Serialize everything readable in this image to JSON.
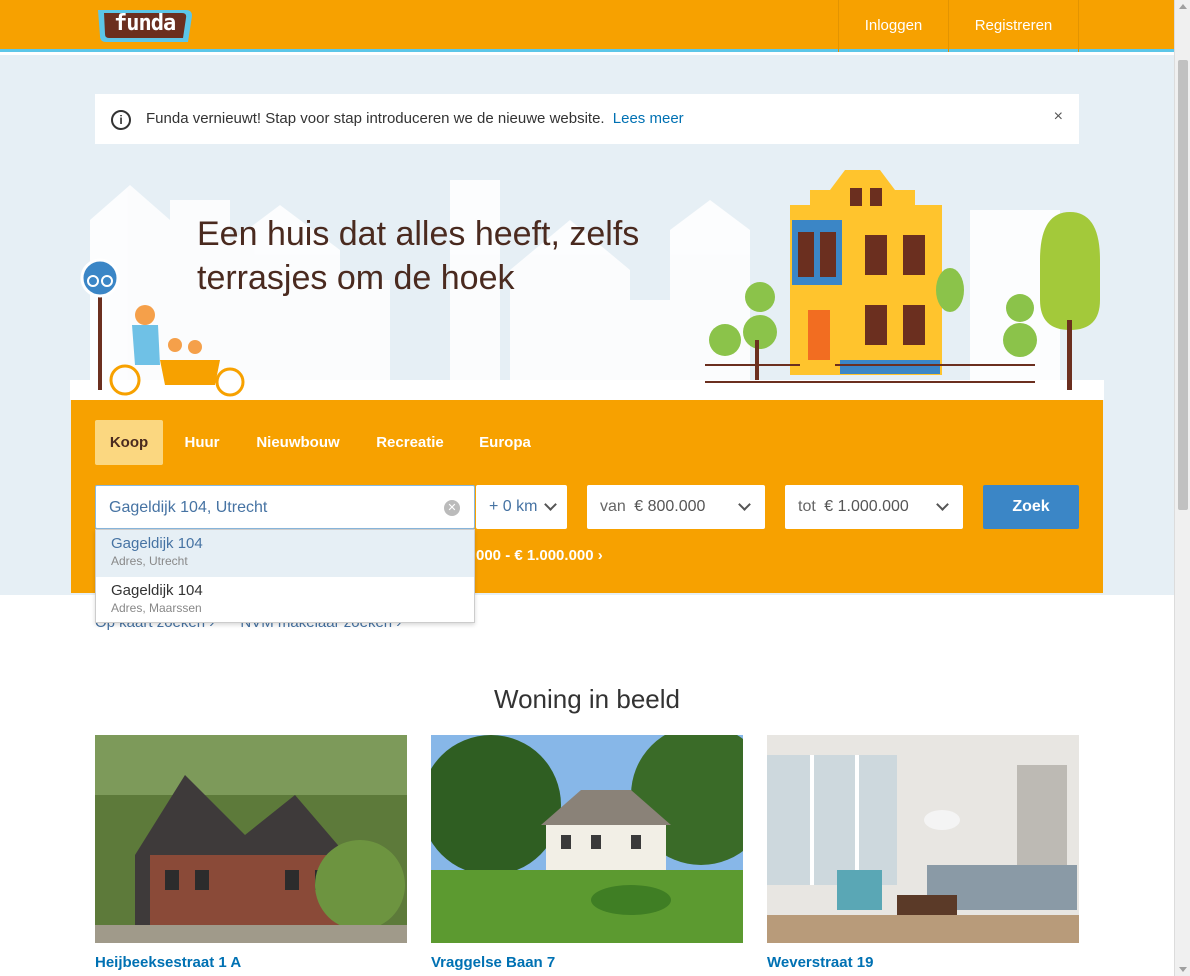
{
  "header": {
    "logo_text": "funda",
    "login_label": "Inloggen",
    "register_label": "Registreren"
  },
  "notice": {
    "text": "Funda vernieuwt! Stap voor stap introduceren we de nieuwe website.",
    "link": "Lees meer",
    "close": "×"
  },
  "hero": {
    "headline_line1": "Een huis dat alles heeft, zelfs",
    "headline_line2": "terrasjes om de hoek"
  },
  "search": {
    "tabs": [
      {
        "label": "Koop",
        "active": true
      },
      {
        "label": "Huur",
        "active": false
      },
      {
        "label": "Nieuwbouw",
        "active": false
      },
      {
        "label": "Recreatie",
        "active": false
      },
      {
        "label": "Europa",
        "active": false
      }
    ],
    "location_value": "Gageldijk 104, Utrecht",
    "radius_value": "+ 0 km",
    "price_from_prefix": "van",
    "price_from_value": "€ 800.000",
    "price_to_prefix": "tot",
    "price_to_value": "€ 1.000.000",
    "submit_label": "Zoek",
    "recent_search": "000 - € 1.000.000  ›",
    "suggestions": [
      {
        "title": "Gageldijk 104",
        "subtitle": "Adres, Utrecht"
      },
      {
        "title": "Gageldijk 104",
        "subtitle": "Adres, Maarssen"
      }
    ]
  },
  "links": {
    "map_search": "Op kaart zoeken  ›",
    "nvm_search": "NVM makelaar zoeken  ›"
  },
  "featured": {
    "title": "Woning in beeld",
    "cards": [
      {
        "title": "Heijbeeksestraat 1 A"
      },
      {
        "title": "Vraggelse Baan 7"
      },
      {
        "title": "Weverstraat 19"
      }
    ]
  },
  "colors": {
    "brand_orange": "#f7a100",
    "link_blue": "#0071b3",
    "button_blue": "#3b86c6"
  }
}
